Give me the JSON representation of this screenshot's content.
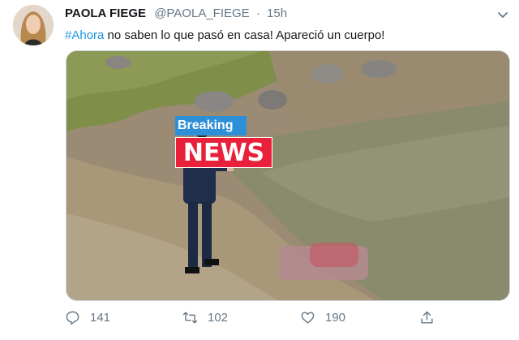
{
  "tweet": {
    "author_name": "PAOLA FIEGE",
    "handle": "@PAOLA_FIEGE",
    "separator": "·",
    "time": "15h",
    "hashtag": "#Ahora",
    "body": " no saben lo que pasó en casa! Apareció un cuerpo!"
  },
  "media": {
    "overlay_top": "Breaking",
    "overlay_main": "NEWS"
  },
  "actions": {
    "replies": "141",
    "retweets": "102",
    "likes": "190"
  },
  "colors": {
    "link": "#1b95e0",
    "muted": "#657786",
    "breaking_blue": "#2e8fd9",
    "news_red": "#e9203a"
  },
  "icons": [
    "avatar",
    "chevron-down-icon",
    "reply-icon",
    "retweet-icon",
    "like-icon",
    "share-icon"
  ]
}
